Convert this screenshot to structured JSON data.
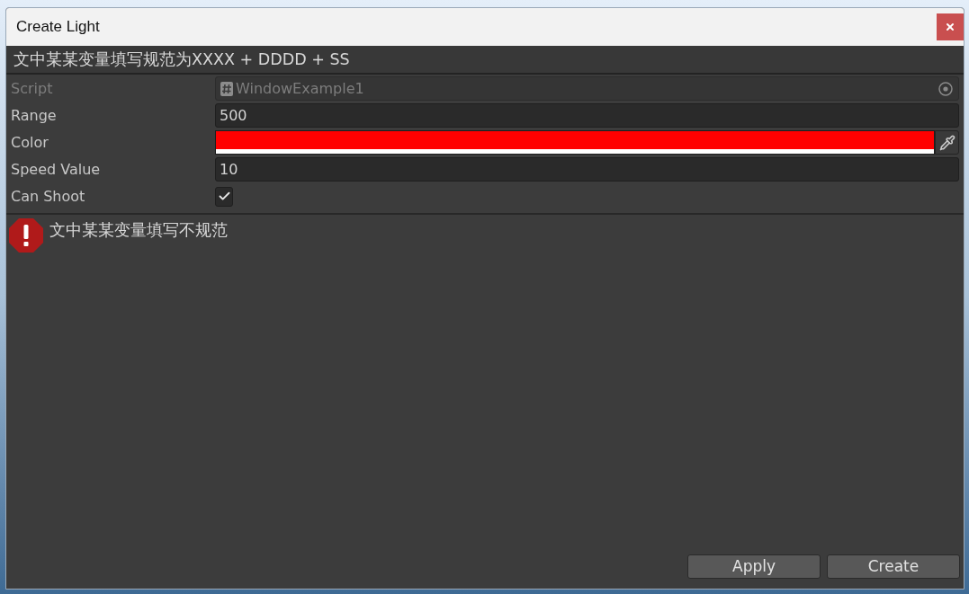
{
  "window": {
    "title": "Create Light"
  },
  "header": "文中某某变量填写规范为XXXX + DDDD + SS",
  "fields": [
    {
      "kind": "object",
      "label": "Script",
      "value": "WindowExample1",
      "disabled": true
    },
    {
      "kind": "number",
      "label": "Range",
      "value": "500",
      "disabled": false
    },
    {
      "kind": "color",
      "label": "Color",
      "color": "#ff0000",
      "level": 1,
      "disabled": false
    },
    {
      "kind": "number",
      "label": "Speed Value",
      "value": "10",
      "disabled": false
    },
    {
      "kind": "checkbox",
      "label": "Can Shoot",
      "checked": true,
      "disabled": false
    }
  ],
  "message": {
    "kind": "error",
    "text": "文中某某变量填写不规范"
  },
  "buttons": [
    {
      "label": "Apply"
    },
    {
      "label": "Create"
    }
  ]
}
